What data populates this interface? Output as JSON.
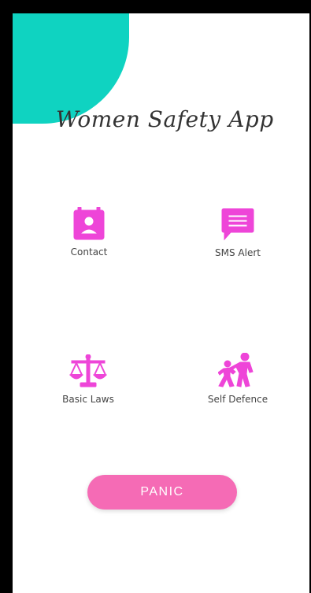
{
  "colors": {
    "accent_teal": "#0fd3c1",
    "icon_pink": "#ee45d8",
    "panic_pink": "#f56bb5"
  },
  "app": {
    "title": "Women Safety App"
  },
  "tiles": [
    {
      "label": "Contact",
      "icon": "contact-book-icon"
    },
    {
      "label": "SMS Alert",
      "icon": "sms-message-icon"
    },
    {
      "label": "Basic Laws",
      "icon": "scales-of-justice-icon"
    },
    {
      "label": "Self Defence",
      "icon": "self-defence-icon"
    }
  ],
  "panic": {
    "label": "PANIC"
  }
}
